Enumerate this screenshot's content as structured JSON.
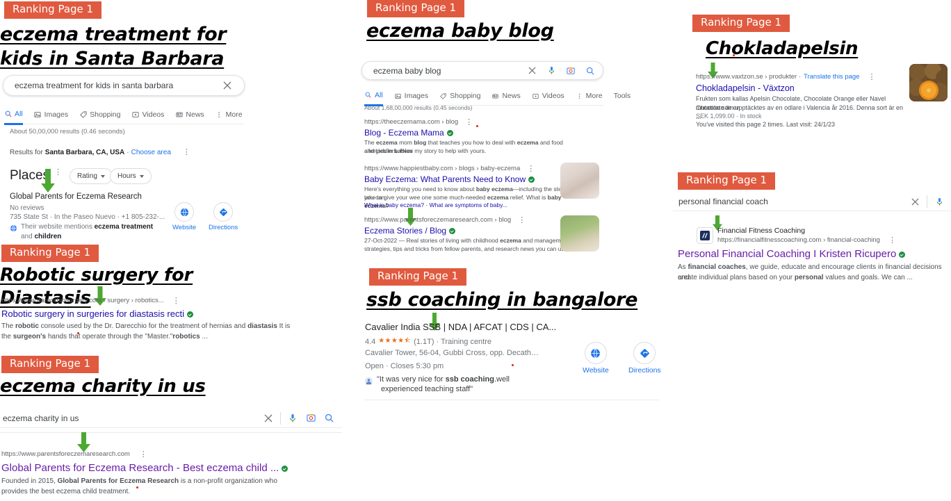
{
  "badge_label": "Ranking Page 1",
  "colors": {
    "badge_bg": "#E05A3F",
    "arrow": "#4CA832",
    "link": "#1a73e8",
    "visited": "#681da8"
  },
  "blocks": {
    "eczema_santa_barbara": {
      "badge": "Ranking Page 1",
      "keyword": "eczema treatment for kids in Santa Barbara",
      "search": {
        "value": "eczema treatment for kids in santa barbara",
        "clear_icon": "close-icon"
      },
      "tabs": [
        {
          "label": "All",
          "icon": "search-icon",
          "active": true
        },
        {
          "label": "Images",
          "icon": "image-icon",
          "active": false
        },
        {
          "label": "Shopping",
          "icon": "tag-icon",
          "active": false
        },
        {
          "label": "Videos",
          "icon": "video-icon",
          "active": false
        },
        {
          "label": "News",
          "icon": "news-icon",
          "active": false
        },
        {
          "label": "More",
          "icon": "more-vertical-icon",
          "active": false
        }
      ],
      "result_stats": "About 50,00,000 results (0.46 seconds)",
      "results_for_prefix": "Results for ",
      "results_for_place": "Santa Barbara, CA, USA",
      "results_for_sep": " · ",
      "choose_area": "Choose area",
      "places_title": "Places",
      "filters": [
        "Rating",
        "Hours"
      ],
      "business": {
        "name": "Global Parents for Eczema Research",
        "reviews": "No reviews",
        "address": "735 State St · In the Paseo Nuevo · +1 805-232-...",
        "mention_prefix": "Their website mentions ",
        "mention_bold": "eczema treatment",
        "mention_mid": " and ",
        "mention_bold2": "children",
        "actions": [
          {
            "label": "Website",
            "icon": "globe-icon"
          },
          {
            "label": "Directions",
            "icon": "directions-icon"
          }
        ]
      }
    },
    "robotic_surgery": {
      "badge": "Ranking Page 1",
      "keyword": "Robotic surgery for Diastasis",
      "url": "https://www.darecchiosurgery.com › surgery › robotics...",
      "title": "Robotic surgery in surgeries for diastasis recti",
      "snippet_1a": "The ",
      "snippet_1b": "robotic",
      "snippet_1c": " console used by the Dr. Darecchio for the treatment of hernias and ",
      "snippet_1d": "diastasis",
      "snippet_1e": " It is",
      "snippet_2a": "the ",
      "snippet_2b": "surgeon's",
      "snippet_2c": " hands that operate through the \"Master.\"",
      "snippet_2d": "robotics",
      "snippet_2e": " ..."
    },
    "eczema_charity": {
      "badge": "Ranking Page 1",
      "keyword": "eczema charity in us",
      "search": {
        "value": "eczema charity in us"
      },
      "url": "https://www.parentsforeczemaresearch.com",
      "title": "Global Parents for Eczema Research - Best eczema child ...",
      "snippet_a": "Founded in 2015, ",
      "snippet_b": "Global Parents for Eczema Research",
      "snippet_c": " is a non-profit organization who",
      "snippet_d": "provides the best eczema child treatment."
    },
    "eczema_baby_blog": {
      "badge": "Ranking Page 1",
      "keyword": "eczema baby blog",
      "search": {
        "value": "eczema baby blog"
      },
      "tabs": [
        {
          "label": "All",
          "icon": "search-icon",
          "active": true
        },
        {
          "label": "Images",
          "icon": "image-icon",
          "active": false
        },
        {
          "label": "Shopping",
          "icon": "tag-icon",
          "active": false
        },
        {
          "label": "News",
          "icon": "news-icon",
          "active": false
        },
        {
          "label": "Videos",
          "icon": "video-icon",
          "active": false
        },
        {
          "label": "More",
          "icon": "more-vertical-icon",
          "active": false
        }
      ],
      "tools_label": "Tools",
      "result_stats": "About 1,68,00,000 results (0.45 seconds)",
      "results": [
        {
          "url": "https://theeczemama.com › blog",
          "title": "Blog - Eczema Mama",
          "snip_1a": "The ",
          "snip_1b": "eczema",
          "snip_1c": " mom ",
          "snip_1d": "blog",
          "snip_1e": " that teaches you how to deal with ",
          "snip_1f": "eczema",
          "snip_1g": " and food allergies in ",
          "snip_1h": "babies",
          "snip_2": "and toddlers. Hear my story to help with yours.",
          "has_thumb": false
        },
        {
          "url": "https://www.happiestbaby.com › blogs › baby-eczema",
          "title": "Baby Eczema: What Parents Need to Know",
          "snip_1a": "Here's everything you need to know about ",
          "snip_1b": "baby eczema",
          "snip_1c": "—including the steps you can",
          "snip_2a": "take to give your wee one some much-needed ",
          "snip_2b": "eczema",
          "snip_2c": " relief. What is ",
          "snip_2d": "baby eczema",
          "snip_2e": "?",
          "snip_3": "What is baby eczema?  ·  What are symptoms of baby...",
          "has_thumb": true
        },
        {
          "url": "https://www.parentsforeczemaresearch.com › blog",
          "title": "Eczema Stories / Blog",
          "snip_1a": "27-Oct-2022 — Real stories of living with childhood ",
          "snip_1b": "eczema",
          "snip_1c": " and management",
          "snip_2": "strategies, tips and tricks from fellow parents, and research news you can use.",
          "has_thumb": true
        }
      ]
    },
    "ssb_coaching": {
      "badge": "Ranking Page 1",
      "keyword": "ssb coaching in bangalore",
      "business": {
        "name": "Cavalier India SSB | NDA | AFCAT | CDS | CA...",
        "rating": "4.4",
        "stars": "★★★★",
        "half_star": "★",
        "reviews": "(1.1T) · Training centre",
        "address": "Cavalier Tower, 56-04, Gubbi Cross, opp. Decath…",
        "hours": "Open · Closes 5:30 pm",
        "review_quote_a": "\"It was very nice for ",
        "review_quote_b": "ssb coaching",
        "review_quote_c": ".well",
        "review_quote_2": "experienced teaching staff\"",
        "actions": [
          {
            "label": "Website",
            "icon": "globe-icon"
          },
          {
            "label": "Directions",
            "icon": "directions-icon"
          }
        ]
      }
    },
    "chokladapelsin": {
      "badge": "Ranking Page 1",
      "keyword": "Chokladapelsin",
      "url": "https://www.vaxtzon.se › produkter  ·  ",
      "translate": "Translate this page",
      "title": "Chokladapelsin - Växtzon",
      "snippet_1": "Frukten som kallas Apelsin Chocolate, Chocolate Orange eller Navel Chocolate är en",
      "snippet_2": "mutation som upptäcktes av en odlare i Valencia år 2016. Denna sort är en ...",
      "price": "SEK 1,099.00 · In stock",
      "visited": "You've visited this page 2 times. Last visit: 24/1/23"
    },
    "personal_financial_coach": {
      "badge": "Ranking Page 1",
      "search": {
        "value": "personal financial coach"
      },
      "site_name": "Financial Fitness Coaching",
      "url": "https://financialfitnesscoaching.com › financial-coaching",
      "title": "Personal Financial Coaching I Kristen Ricupero",
      "snip_a": "As ",
      "snip_b": "financial coaches",
      "snip_c": ", we guide, educate and encourage clients in financial decisions and",
      "snip_d": "create individual plans based on your ",
      "snip_e": "personal",
      "snip_f": " values and goals. We can ..."
    }
  }
}
